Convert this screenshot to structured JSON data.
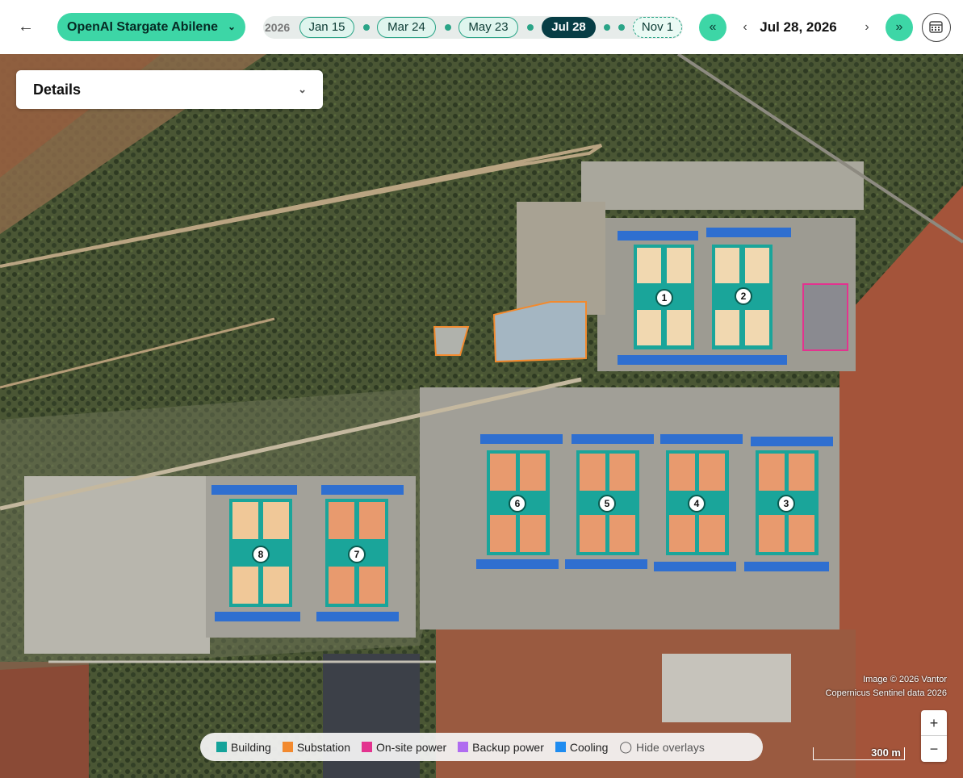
{
  "header": {
    "site_name": "OpenAI Stargate Abilene",
    "timeline": {
      "year_fragment": "2026",
      "dates": [
        "Jan 15",
        "Mar 24",
        "May 23",
        "Jul 28",
        "Nov 1"
      ],
      "active": "Jul 28"
    },
    "current_date": "Jul 28, 2026"
  },
  "details": {
    "label": "Details"
  },
  "buildings": [
    "1",
    "2",
    "3",
    "4",
    "5",
    "6",
    "7",
    "8"
  ],
  "attribution": {
    "line1": "Image © 2026 Vantor",
    "line2": "Copernicus Sentinel data 2026"
  },
  "legend": {
    "items": [
      {
        "label": "Building",
        "color": "#14a39a"
      },
      {
        "label": "Substation",
        "color": "#f28a2e"
      },
      {
        "label": "On-site power",
        "color": "#e3338f"
      },
      {
        "label": "Backup power",
        "color": "#b06cf0"
      },
      {
        "label": "Cooling",
        "color": "#1f8cf0"
      }
    ],
    "hide_label": "Hide overlays"
  },
  "scale_label": "300 m",
  "colors": {
    "accent": "#3dd6a6",
    "active_pill": "#073d45"
  }
}
